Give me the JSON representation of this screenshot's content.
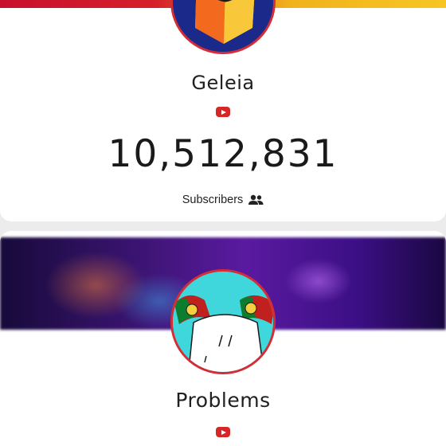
{
  "channels": [
    {
      "name": "Geleia",
      "platform_icon": "youtube-icon",
      "subscriber_count": "10,512,831",
      "subscribers_label": "Subscribers",
      "subscribers_icon": "people-icon"
    },
    {
      "name": "Problems",
      "platform_icon": "youtube-icon"
    }
  ],
  "colors": {
    "youtube_red": "#d62626",
    "avatar_border": "#d42d35",
    "page_bg": "#ececec"
  }
}
